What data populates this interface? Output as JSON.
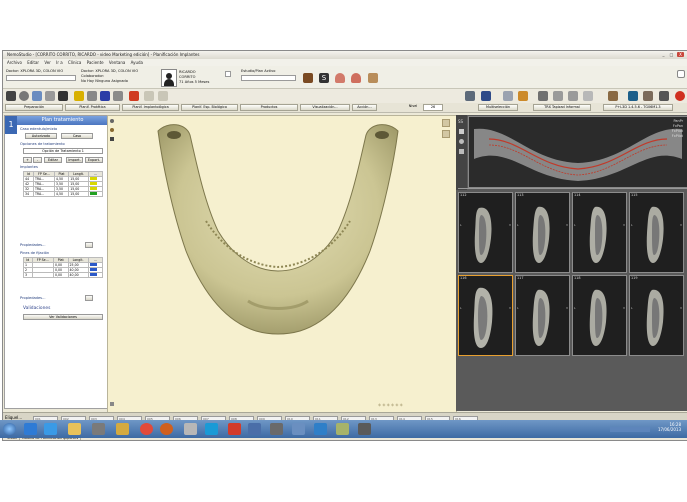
{
  "window": {
    "title": "NemoStudio - [CORRITO CORRITO, RICARDO - video Marketing edición] - Planificación Implantes",
    "buttons": [
      "_",
      "□",
      "X"
    ]
  },
  "menu": [
    "Archivo",
    "Editar",
    "Ver",
    "Ir a",
    "Clínica",
    "Paciente",
    "Ventana",
    "Ayuda"
  ],
  "info": {
    "doctor_label": "Doctor: XPLORA 3D, COLON VIO",
    "doctor_label2": "Doctor: XPLORA 3D, COLON VIO",
    "colaborador": "Colaborador:",
    "assistant": "No Hay Ninguno Asignado",
    "patient_lines": [
      "RICARDO",
      "CORRITO",
      "71 Años 5 Meses"
    ],
    "study_label": "Estudio/Plan Activo"
  },
  "ribbon": [
    "Preparación",
    "Planif. Protética",
    "Planif. Implantológica",
    "Planif. Esp. Biológico",
    "Productos",
    "Visualización...",
    "Acción...",
    "Nivel",
    "26",
    "Multiselección",
    "TRX Tapizad Informal",
    "P+L3D 1.4.5.6 - TG06M1.3"
  ],
  "left_panel": {
    "tab_number": "1",
    "title": "Plan tratamiento",
    "edentulous_title": "Caso edentulo/mixto",
    "edentulous_btns": [
      "Autorizado",
      "Caso"
    ],
    "options_title": "Opciones de tratamiento",
    "option_selected": "Opción de Tratamiento 1",
    "option_btns": [
      "+",
      "-",
      "Editar",
      "Import.",
      "Export."
    ],
    "implants_title": "Implantes",
    "implant_headers": [
      "Id",
      "FP Se...",
      "Plat",
      "Longit.",
      "..."
    ],
    "implants": [
      {
        "id": "44",
        "name": "TRA...",
        "plat": "4,50",
        "len": "15,00",
        "color": "#d8d800"
      },
      {
        "id": "42",
        "name": "TRA...",
        "plat": "3,50",
        "len": "15,00",
        "color": "#d8d800"
      },
      {
        "id": "32",
        "name": "TRA...",
        "plat": "3,50",
        "len": "15,00",
        "color": "#d8d800"
      },
      {
        "id": "34",
        "name": "TRA...",
        "plat": "4,50",
        "len": "15,00",
        "color": "#22a022"
      }
    ],
    "props1": "Propiedades...",
    "pins_title": "Pines de fijación",
    "pin_headers": [
      "Id",
      "FP Se...",
      "Plat",
      "Longit.",
      "..."
    ],
    "pins": [
      {
        "id": "1",
        "name": "",
        "plat": "0,00",
        "len": "25,00",
        "color": "#2a58c8"
      },
      {
        "id": "2",
        "name": "",
        "plat": "0,00",
        "len": "40,00",
        "color": "#2a58c8"
      },
      {
        "id": "3",
        "name": "",
        "plat": "0,00",
        "len": "40,00",
        "color": "#2a58c8"
      }
    ],
    "props2": "Propiedades...",
    "validation_title": "Validaciones",
    "validation_btn": "Ver Validaciones"
  },
  "ct": {
    "pano_labels": [
      "SS",
      "PanPr",
      "FxPan",
      "FxPilot",
      "FxPilot"
    ],
    "slices": [
      "112",
      "113",
      "114",
      "115",
      "116",
      "117",
      "118",
      "119"
    ],
    "selected_slice": 4
  },
  "strip": {
    "label": "Eliquel...",
    "refresh": "Refrescar",
    "thumbs": [
      "001",
      "002",
      "003",
      "004",
      "005",
      "006",
      "007",
      "008",
      "009",
      "010",
      "011",
      "012",
      "013",
      "014",
      "015",
      "016"
    ]
  },
  "status_tabs": [
    "Visión",
    "Modelo de Planificación",
    "Reportes"
  ],
  "taskbar": {
    "time": "16:28",
    "date": "17/06/2013"
  },
  "colors": {
    "accent": "#3b68b3",
    "bone": "#d9d4a8",
    "viewport_bg": "#f6f0cf"
  }
}
